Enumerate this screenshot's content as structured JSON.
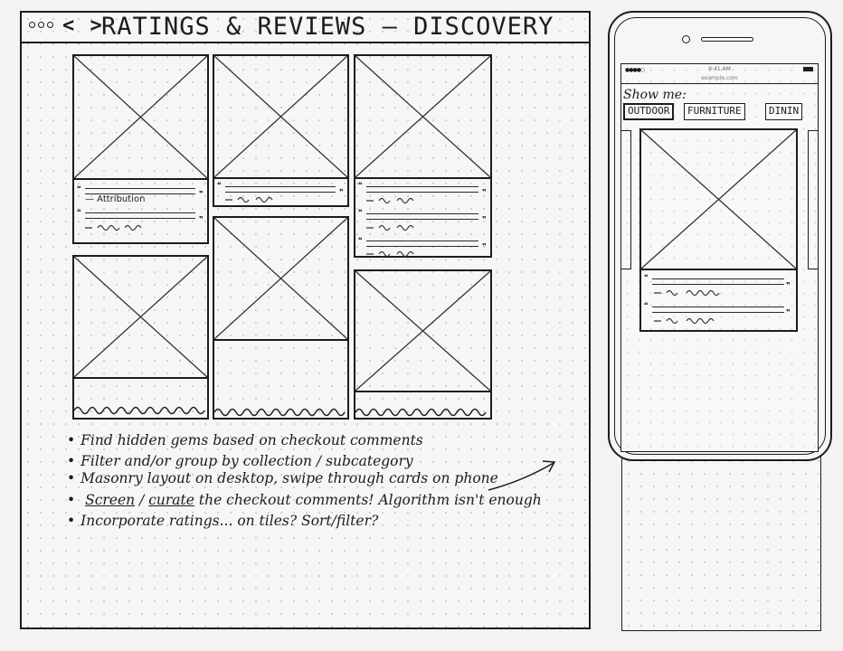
{
  "desktop": {
    "window_controls": "ooo",
    "nav_arrows": "< >",
    "title": "RATINGS & REVIEWS — DISCOVERY",
    "attribution_label": "— Attribution"
  },
  "notes": [
    "Find hidden gems based on checkout comments",
    "Filter and/or group by collection / subcategory",
    "Masonry layout on desktop, swipe through cards on phone",
    "Incorporate ratings... on tiles? Sort/filter?"
  ],
  "note_screen": {
    "screen": "Screen",
    "sep": " / ",
    "curate": "curate",
    "rest": " the checkout comments! Algorithm isn't enough"
  },
  "phone": {
    "time": "9:41 AM",
    "url": "example.com",
    "show_me": "Show me:",
    "chips": [
      "OUTDOOR",
      "FURNITURE",
      "DININ"
    ]
  }
}
